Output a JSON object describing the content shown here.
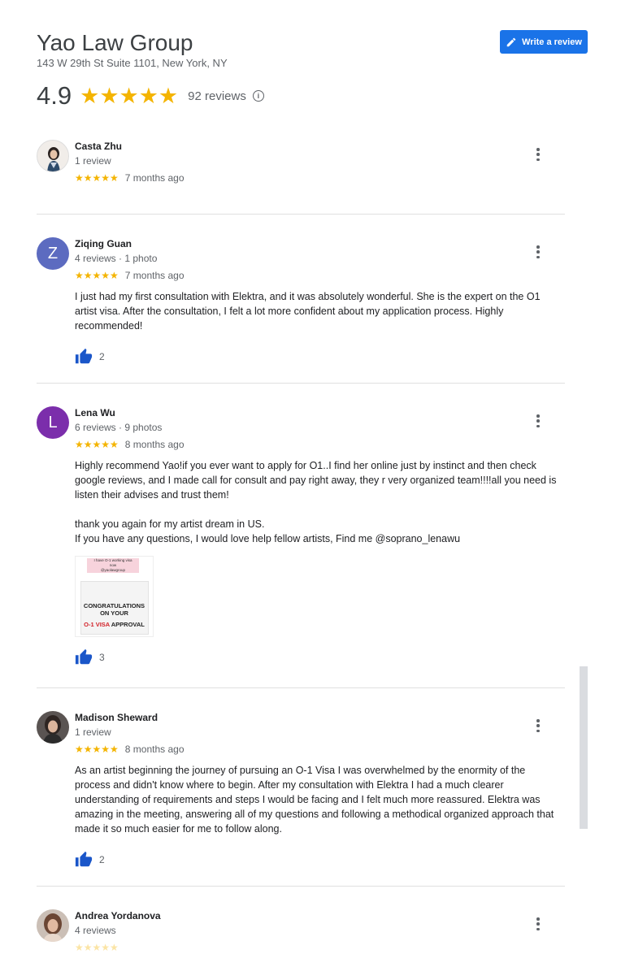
{
  "business": {
    "name": "Yao Law Group",
    "address": "143 W 29th St Suite 1101, New York, NY",
    "rating": "4.9",
    "stars": "★★★★★",
    "review_count": "92 reviews",
    "write_review_label": "Write a review"
  },
  "colors": {
    "accent": "#1a73e8",
    "star": "#f4b400",
    "like": "#1a56c9"
  },
  "reviews": [
    {
      "name": "Casta Zhu",
      "meta": "1 review",
      "stars": "★★★★★",
      "time": "7 months ago",
      "text": "",
      "likes": ""
    },
    {
      "name": "Ziqing Guan",
      "avatar_letter": "Z",
      "meta": "4 reviews · 1 photo",
      "stars": "★★★★★",
      "time": "7 months ago",
      "text": "I just had my first consultation with Elektra, and it was absolutely wonderful. She is the expert on the O1 artist visa. After the consultation, I felt a lot more confident about my application process. Highly recommended!",
      "likes": "2"
    },
    {
      "name": "Lena Wu",
      "avatar_letter": "L",
      "meta": "6 reviews · 9 photos",
      "stars": "★★★★★",
      "time": "8 months ago",
      "text": "Highly recommend Yao!if you ever want to apply for O1..I find her online just by instinct and then check google reviews, and I made call for consult and pay right away, they r very organized team!!!!all you need is listen their advises and trust them!\n\nthank you again for my artist dream in US.\nIf you have any questions, I would love help fellow artists, Find me @soprano_lenawu",
      "photo": {
        "line1": "I have O-1 working visa",
        "line2": "now",
        "line3": "@yaolawgroup",
        "heading1": "CONGRATULATIONS",
        "heading2": "ON YOUR",
        "heading3_red": "O-1 VISA",
        "heading3_rest": " APPROVAL"
      },
      "likes": "3"
    },
    {
      "name": "Madison Sheward",
      "meta": "1 review",
      "stars": "★★★★★",
      "time": "8 months ago",
      "text": "As an artist beginning the journey of pursuing an O-1 Visa I was overwhelmed by the enormity of the process and didn't know where to begin. After my consultation with Elektra I had a much clearer understanding of requirements and steps I would be facing and I felt much more reassured. Elektra was amazing in the meeting, answering all of my questions and following a methodical organized approach that made it so much easier for me to follow along.",
      "likes": "2"
    },
    {
      "name": "Andrea Yordanova",
      "meta": "4 reviews",
      "stars": "★★★★★",
      "time": "",
      "text": "",
      "likes": ""
    }
  ]
}
